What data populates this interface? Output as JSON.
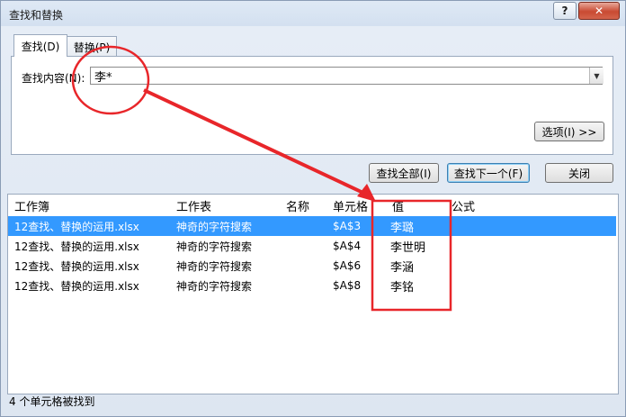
{
  "window": {
    "title": "查找和替换",
    "help_glyph": "?",
    "close_glyph": "✕"
  },
  "tabs": [
    {
      "label": "查找(D)"
    },
    {
      "label": "替换(P)"
    }
  ],
  "find": {
    "label": "查找内容(N):",
    "value": "李*",
    "dropdown_glyph": "▼"
  },
  "buttons": {
    "options": "选项(I) >>",
    "find_all": "查找全部(I)",
    "find_next": "查找下一个(F)",
    "close": "关闭"
  },
  "results": {
    "columns": [
      "工作簿",
      "工作表",
      "名称",
      "单元格",
      "值",
      "公式"
    ],
    "rows": [
      {
        "book": "12查找、替换的运用.xlsx",
        "sheet": "神奇的字符搜索",
        "name": "",
        "cell": "$A$3",
        "value": "李璐",
        "formula": ""
      },
      {
        "book": "12查找、替换的运用.xlsx",
        "sheet": "神奇的字符搜索",
        "name": "",
        "cell": "$A$4",
        "value": "李世明",
        "formula": ""
      },
      {
        "book": "12查找、替换的运用.xlsx",
        "sheet": "神奇的字符搜索",
        "name": "",
        "cell": "$A$6",
        "value": "李涵",
        "formula": ""
      },
      {
        "book": "12查找、替换的运用.xlsx",
        "sheet": "神奇的字符搜索",
        "name": "",
        "cell": "$A$8",
        "value": "李铭",
        "formula": ""
      }
    ],
    "selected_row": 0,
    "status": "4 个单元格被找到"
  },
  "annotation": {
    "color": "#e8262a"
  }
}
